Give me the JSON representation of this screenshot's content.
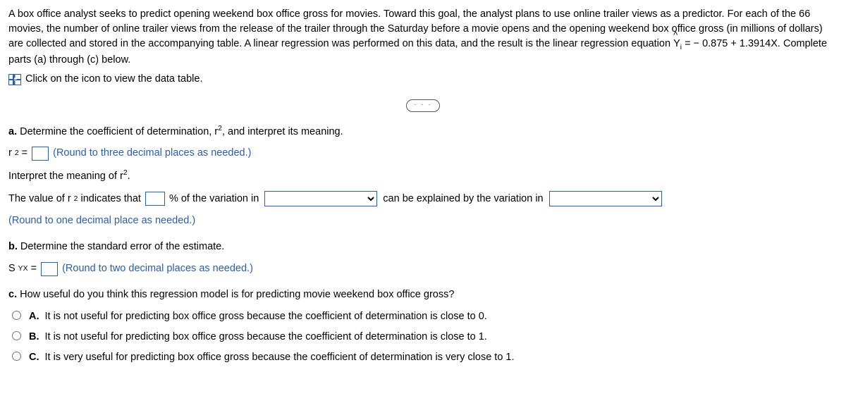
{
  "intro": {
    "p1": "A box office analyst seeks to predict opening weekend box office gross for movies. Toward this goal, the analyst plans to use online trailer views as a predictor. For each of the 66 movies, the number of online trailer views from the release of the trailer through the Saturday before a movie opens and the opening weekend box office gross (in millions of dollars) are collected and stored in the accompanying table. A linear regression was performed on this data, and the result is the linear regression equation ",
    "eqY": "Y",
    "eqSub": "i",
    "eqRest": " = − 0.875 + 1.3914X. Complete parts (a) through (c) below.",
    "clickText": "Click on the icon to view the data table."
  },
  "a": {
    "prompt_pre": "a.",
    "prompt": " Determine the coefficient of determination, r",
    "prompt_post": ", and interpret its meaning.",
    "r2eq_pre": "r",
    "r2eq_eq": " = ",
    "r2_hint": "(Round to three decimal places as needed.)",
    "interp_head_pre": "Interpret the meaning of r",
    "interp_head_post": ".",
    "sentence_p1": "The value of r",
    "sentence_p2": " indicates that ",
    "sentence_p3": "% of the variation in ",
    "sentence_p4": " can be explained by the variation in ",
    "round_hint": "(Round to one decimal place as needed.)"
  },
  "b": {
    "prompt_pre": "b.",
    "prompt": " Determine the standard error of the estimate.",
    "syx_pre": "S",
    "syx_sub": "YX",
    "syx_eq": " = ",
    "hint": "(Round to two decimal places as needed.)"
  },
  "c": {
    "prompt_pre": "c.",
    "prompt": " How useful do you think this regression model is for predicting movie weekend box office gross?",
    "options": {
      "A_label": "A.",
      "A": "It is not useful for predicting box office gross because the coefficient of determination is close to 0.",
      "B_label": "B.",
      "B": "It is not useful for predicting box office gross because the coefficient of determination is close to 1.",
      "C_label": "C.",
      "C": "It is very useful for predicting box office gross because the coefficient of determination is very close to 1."
    }
  }
}
